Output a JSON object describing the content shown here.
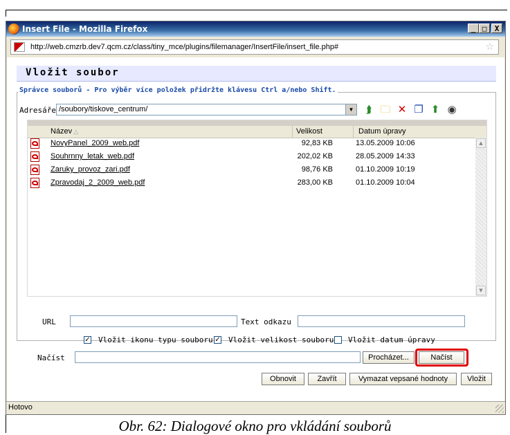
{
  "window": {
    "title": "Insert File - Mozilla Firefox"
  },
  "window_buttons": {
    "minimize": "_",
    "maximize": "□",
    "close": "X"
  },
  "urlbar": {
    "url": "http://web.cmzrb.dev7.qcm.cz/class/tiny_mce/plugins/filemanager/InsertFile/insert_file.php#"
  },
  "dialog": {
    "heading": "Vložit soubor",
    "legend": "Správce souborů - Pro výběr více položek přidržte klávesu Ctrl a/nebo Shift.",
    "directory_label": "Adresáře",
    "directory_value": "/soubory/tiskove_centrum/",
    "columns": {
      "name": "Název",
      "size": "Velikost",
      "date": "Datum úpravy"
    },
    "files": [
      {
        "name": "NovyPanel_2009_web.pdf",
        "size": "92,83 KB",
        "date": "13.05.2009 10:06"
      },
      {
        "name": "Souhrnny_letak_web.pdf",
        "size": "202,02 KB",
        "date": "28.05.2009 14:33"
      },
      {
        "name": "Zaruky_provoz_zari.pdf",
        "size": "98,76 KB",
        "date": "01.10.2009 10:19"
      },
      {
        "name": "Zpravodaj_2_2009_web.pdf",
        "size": "283,00 KB",
        "date": "01.10.2009 10:04"
      }
    ],
    "url_label": "URL",
    "url_value": "",
    "link_text_label": "Text odkazu",
    "link_text_value": "",
    "options": [
      {
        "label": "Vložit ikonu typu souboru",
        "checked": true,
        "mark": "✓"
      },
      {
        "label": "Vložit velikost souboru",
        "checked": true,
        "mark": "✓"
      },
      {
        "label": "Vložit datum úpravy",
        "checked": false,
        "mark": ""
      }
    ],
    "upload_label": "Načíst",
    "upload_value": "",
    "browse_button": "Procházet...",
    "upload_button": "Načíst",
    "buttons": {
      "refresh": "Obnovit",
      "close": "Zavřít",
      "clear": "Vymazat vepsané hodnoty",
      "insert": "Vložit"
    }
  },
  "statusbar": {
    "text": "Hotovo"
  },
  "caption": "Obr. 62: Dialogové okno pro vkládání souborů",
  "colors": {
    "titlebar": "#0a246a",
    "legend": "#1a4aa8",
    "heading_bg": "#e6e9ff",
    "highlight": "#e00000"
  },
  "icons": [
    "firefox-icon",
    "site-icon",
    "bookmark-star-icon",
    "folder-up-icon",
    "new-folder-icon",
    "delete-icon",
    "copy-icon",
    "upload-icon",
    "preview-icon",
    "pdf-icon"
  ]
}
